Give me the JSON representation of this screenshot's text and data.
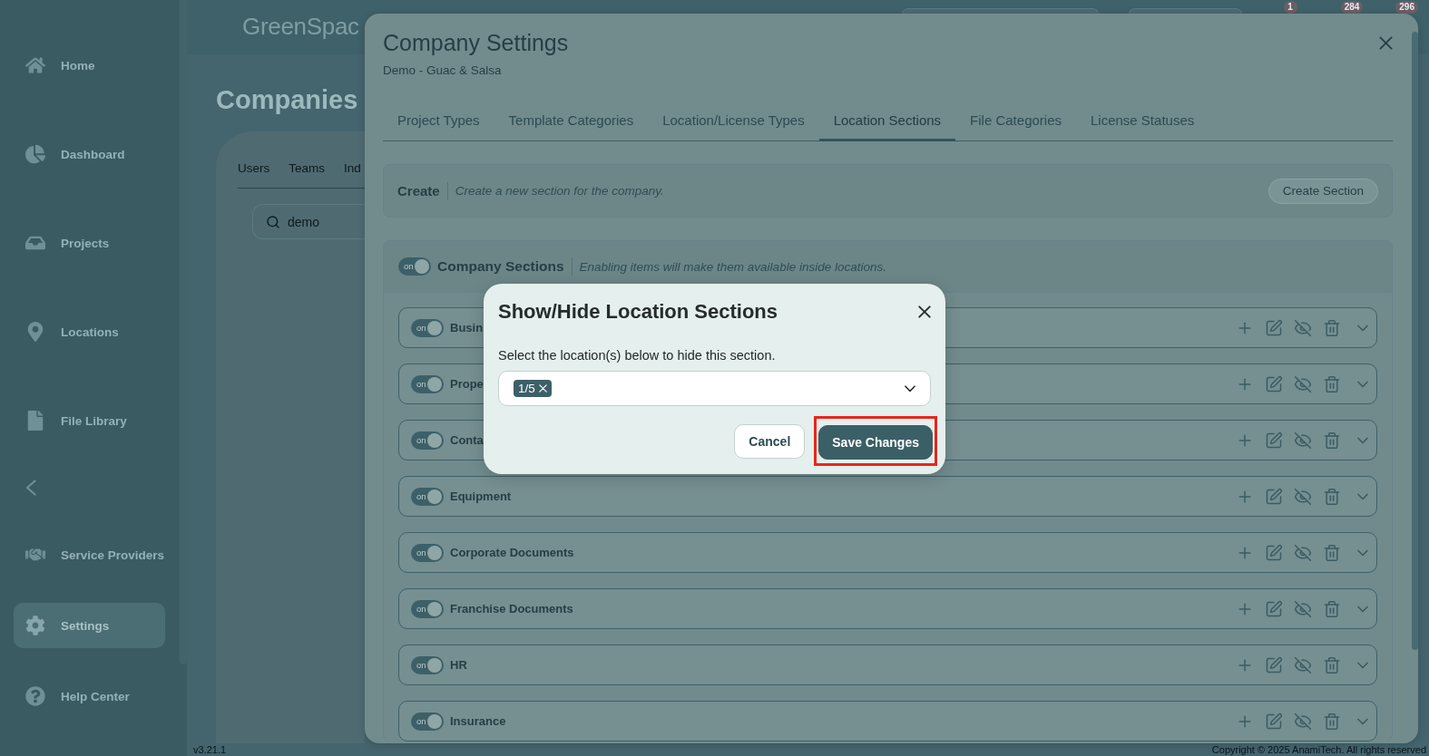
{
  "sidebar": {
    "top_items": [
      {
        "label": "Home",
        "selected": false
      },
      {
        "label": "Dashboard",
        "selected": false
      },
      {
        "label": "Projects",
        "selected": false
      },
      {
        "label": "Locations",
        "selected": false
      },
      {
        "label": "File Library",
        "selected": false
      }
    ],
    "bottom_items": [
      {
        "label": "Service Providers",
        "selected": false
      },
      {
        "label": "Settings",
        "selected": true
      },
      {
        "label": "Help Center",
        "selected": false
      }
    ]
  },
  "top_bar": {
    "logo": "GreenSpac",
    "badges": [
      "1",
      "284",
      "296"
    ]
  },
  "page": {
    "title": "Companies",
    "tabs": [
      {
        "label": "Users",
        "selected": false
      },
      {
        "label": "Teams",
        "selected": false
      },
      {
        "label": "Ind",
        "selected": false
      }
    ],
    "search": {
      "value": "demo"
    }
  },
  "footer": {
    "version": "v3.21.1",
    "copyright": "Copyright © 2025 AnamiTech. All rights reserved"
  },
  "settings_modal": {
    "title": "Company Settings",
    "subtitle": "Demo - Guac & Salsa",
    "tabs": [
      {
        "label": "Project Types",
        "selected": false
      },
      {
        "label": "Template Categories",
        "selected": false
      },
      {
        "label": "Location/License Types",
        "selected": false
      },
      {
        "label": "Location Sections",
        "selected": true
      },
      {
        "label": "File Categories",
        "selected": false
      },
      {
        "label": "License Statuses",
        "selected": false
      }
    ],
    "create": {
      "label": "Create",
      "hint": "Create a new section for the company.",
      "button": "Create Section"
    },
    "sections": {
      "toggle": {
        "on": true,
        "label": "on"
      },
      "title": "Company Sections",
      "hint": "Enabling items will make them available inside locations.",
      "rows": [
        {
          "name": "Busin",
          "toggle": {
            "on": true,
            "label": "on"
          }
        },
        {
          "name": "Prope",
          "toggle": {
            "on": true,
            "label": "on"
          }
        },
        {
          "name": "Conta",
          "toggle": {
            "on": true,
            "label": "on"
          }
        },
        {
          "name": "Equipment",
          "toggle": {
            "on": true,
            "label": "on"
          }
        },
        {
          "name": "Corporate Documents",
          "toggle": {
            "on": true,
            "label": "on"
          }
        },
        {
          "name": "Franchise Documents",
          "toggle": {
            "on": true,
            "label": "on"
          }
        },
        {
          "name": "HR",
          "toggle": {
            "on": true,
            "label": "on"
          }
        },
        {
          "name": "Insurance",
          "toggle": {
            "on": true,
            "label": "on"
          }
        }
      ]
    }
  },
  "dialog": {
    "title": "Show/Hide Location Sections",
    "prompt": "Select the location(s) below to hide this section.",
    "tags": [
      "1/5"
    ],
    "buttons": [
      {
        "label": "Cancel",
        "kind": "secondary",
        "highlighted": false
      },
      {
        "label": "Save Changes",
        "kind": "primary",
        "highlighted": true
      }
    ]
  }
}
